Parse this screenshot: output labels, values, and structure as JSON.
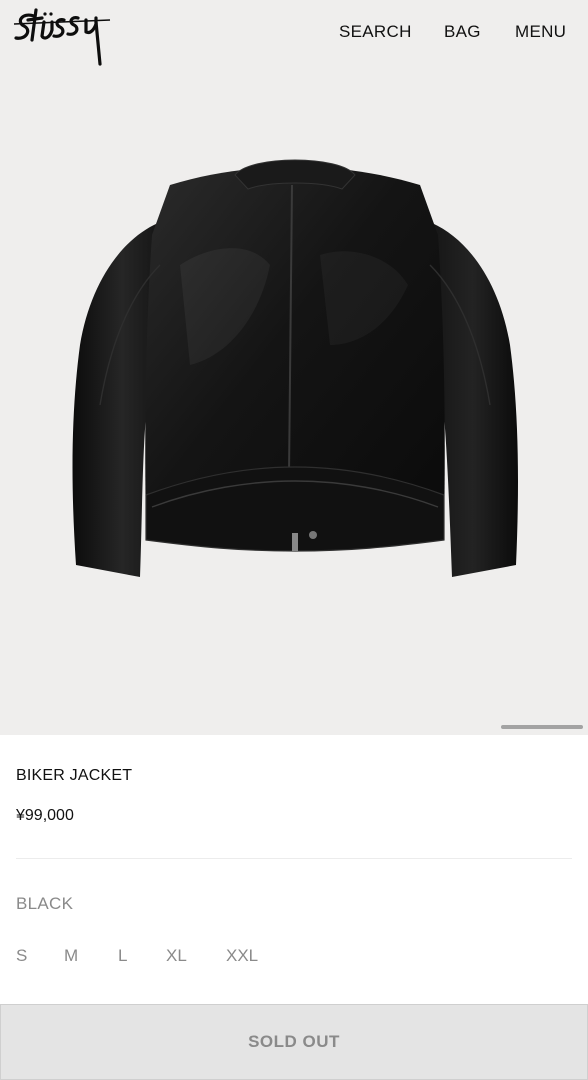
{
  "header": {
    "logo_text": "Stüssy",
    "search_label": "SEARCH",
    "bag_label": "BAG",
    "menu_label": "MENU"
  },
  "product": {
    "name": "BIKER JACKET",
    "price": "¥99,000",
    "color": "BLACK",
    "sizes": [
      "S",
      "M",
      "L",
      "XL",
      "XXL"
    ],
    "status_button": "SOLD OUT",
    "image": "black-leather-biker-jacket-back-view"
  },
  "colors": {
    "hero_background": "#efeeed",
    "muted_text": "#8a8a8a",
    "button_background": "#e4e4e4"
  }
}
